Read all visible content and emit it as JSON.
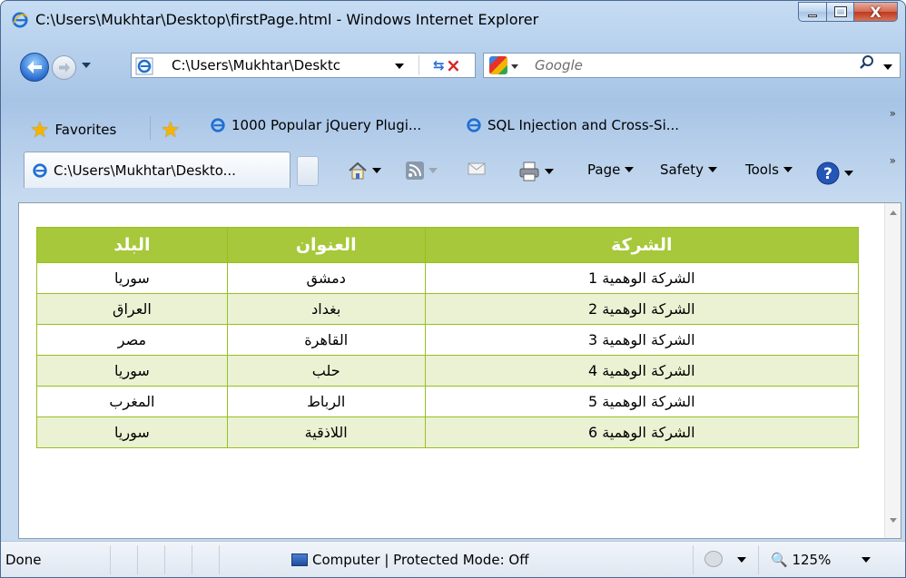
{
  "window": {
    "title": "C:\\Users\\Mukhtar\\Desktop\\firstPage.html - Windows Internet Explorer"
  },
  "address_bar": {
    "value": "C:\\Users\\Mukhtar\\Desktc",
    "search_placeholder": "Google"
  },
  "favorites_bar": {
    "favorites_label": "Favorites",
    "links": [
      {
        "label": "1000 Popular jQuery Plugi..."
      },
      {
        "label": "SQL Injection and Cross-Si..."
      }
    ]
  },
  "tabs": [
    {
      "label": "C:\\Users\\Mukhtar\\Deskto..."
    }
  ],
  "command_bar": {
    "page": "Page",
    "safety": "Safety",
    "tools": "Tools"
  },
  "table": {
    "headers": [
      "الشركة",
      "العنوان",
      "البلد"
    ],
    "rows": [
      [
        "الشركة الوهمية 1",
        "دمشق",
        "سوريا"
      ],
      [
        "الشركة الوهمية 2",
        "بغداد",
        "العراق"
      ],
      [
        "الشركة الوهمية 3",
        "القاهرة",
        "مصر"
      ],
      [
        "الشركة الوهمية 4",
        "حلب",
        "سوريا"
      ],
      [
        "الشركة الوهمية 5",
        "الرباط",
        "المغرب"
      ],
      [
        "الشركة الوهمية 6",
        "اللاذقية",
        "سوريا"
      ]
    ]
  },
  "status_bar": {
    "status": "Done",
    "zone": "Computer | Protected Mode: Off",
    "zoom": "125%"
  },
  "colors": {
    "header_bg": "#a6c83a",
    "border": "#98bf21",
    "alt_row_bg": "#eaf2d3"
  },
  "icons": [
    "ie-icon",
    "back-arrow-icon",
    "forward-arrow-icon",
    "refresh-icon",
    "stop-icon",
    "google-icon",
    "search-icon",
    "favorites-star-icon",
    "add-favorites-icon",
    "home-icon",
    "rss-icon",
    "mail-icon",
    "print-icon",
    "help-icon",
    "globe-icon",
    "zoom-icon"
  ]
}
